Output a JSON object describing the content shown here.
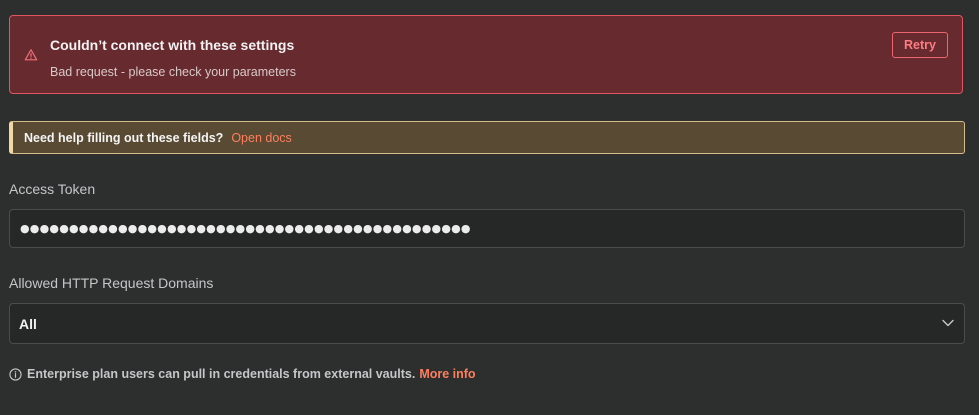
{
  "error": {
    "title": "Couldn’t connect with these settings",
    "message": "Bad request - please check your parameters",
    "retry_label": "Retry",
    "icon": "warning-icon"
  },
  "help": {
    "text": "Need help filling out these fields?",
    "link_label": "Open docs"
  },
  "token": {
    "label": "Access Token",
    "value": "●●●●●●●●●●●●●●●●●●●●●●●●●●●●●●●●●●●●●●●●●●●●●●"
  },
  "domains": {
    "label": "Allowed HTTP Request Domains",
    "selected": "All",
    "icon": "chevron-down-icon"
  },
  "footer": {
    "text": "Enterprise plan users can pull in credentials from external vaults.",
    "link_label": "More info",
    "icon": "info-icon"
  },
  "colors": {
    "background": "#2d2e2e",
    "error_bg": "#662a2f",
    "error_border": "#e0555f",
    "notice_bg": "#584a33",
    "accent_link": "#ff7e5c"
  }
}
